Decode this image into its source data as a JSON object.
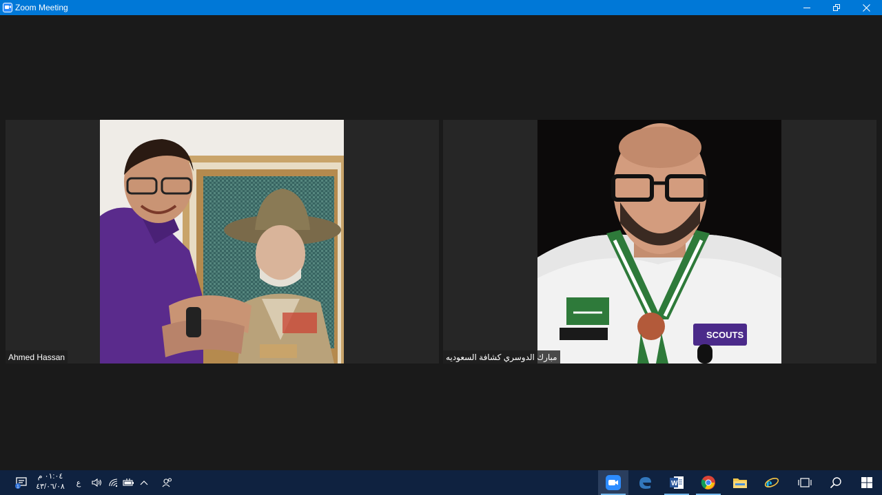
{
  "window": {
    "title": "Zoom Meeting",
    "accent": "#0078d7"
  },
  "participants": [
    {
      "name": "Ahmed Hassan"
    },
    {
      "name": "مبارك الدوسري كشافة السعوديه"
    }
  ],
  "taskbar": {
    "clock_time": "٠١:٠٤ م",
    "clock_date": "٤٣/٠٦/٠٨",
    "lang_indicator": "ع",
    "background": "#0f2240"
  }
}
